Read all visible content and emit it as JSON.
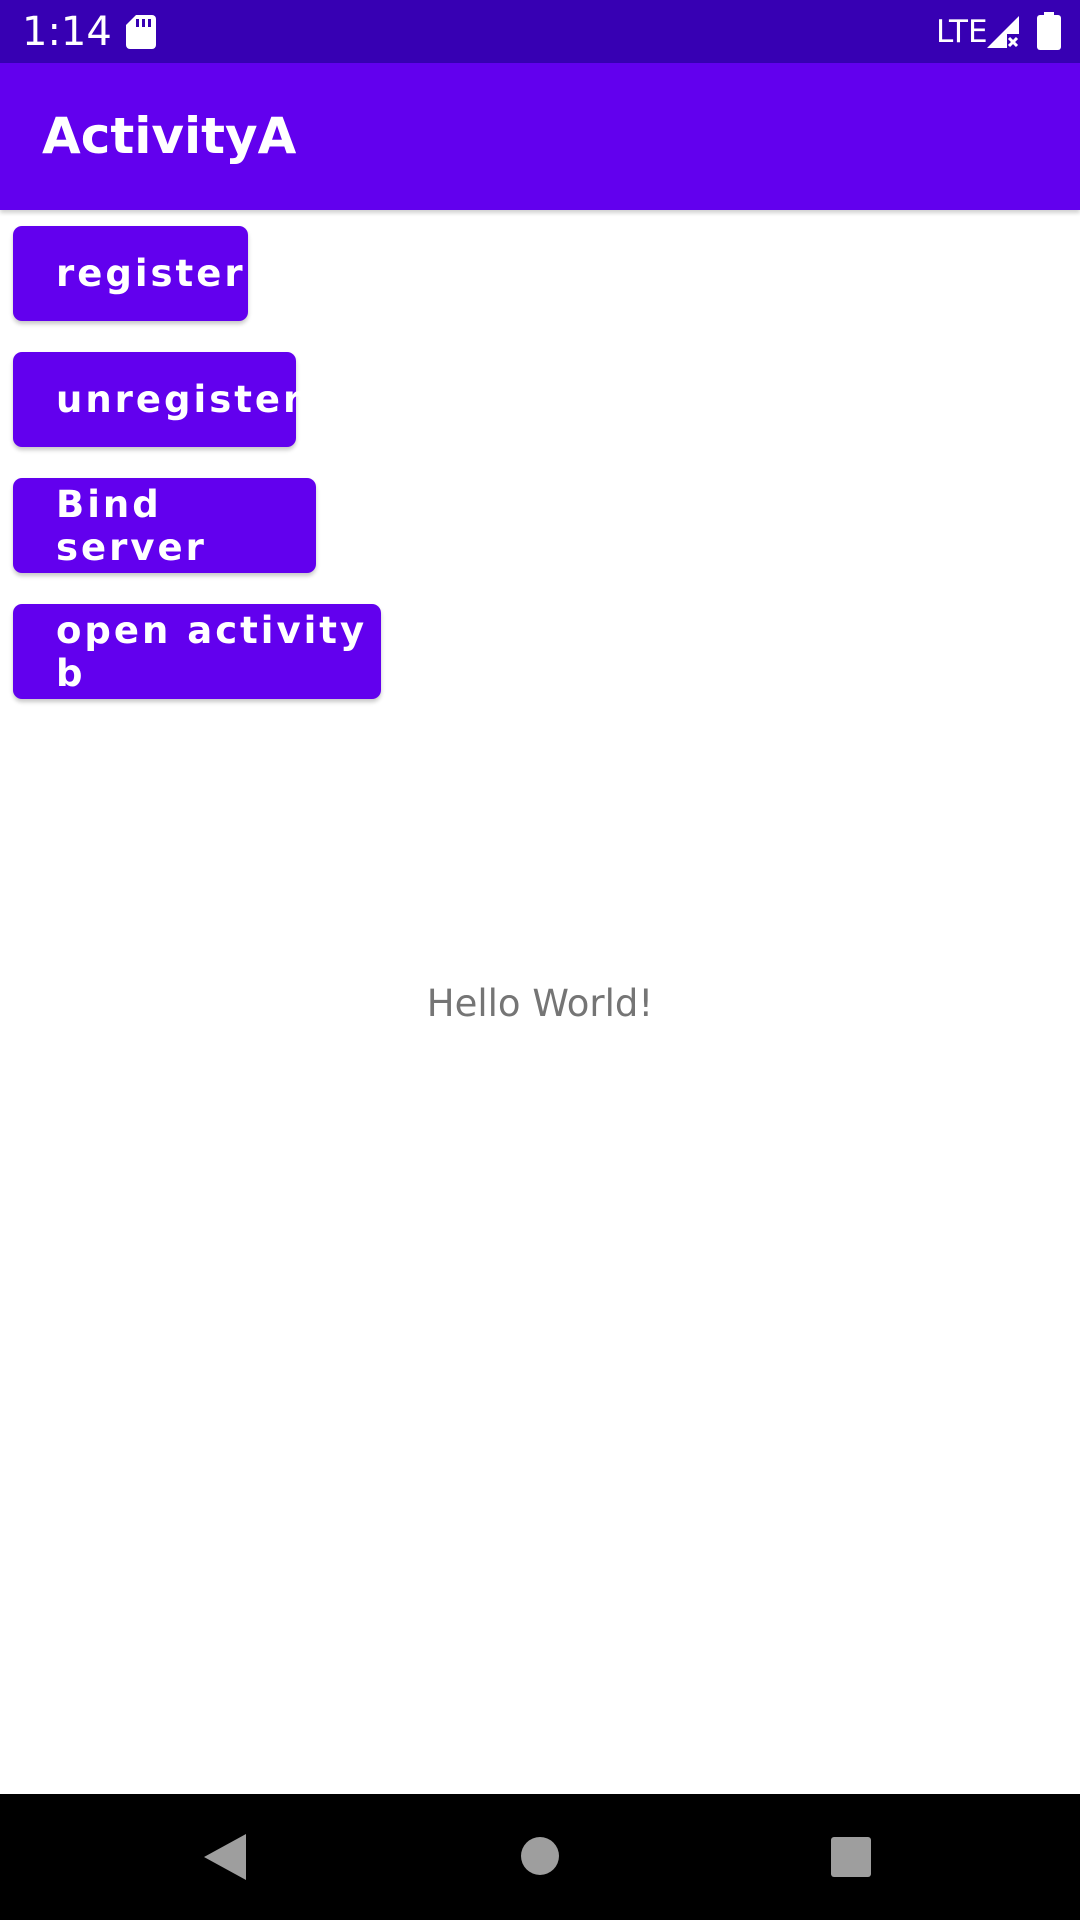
{
  "status_bar": {
    "time": "1:14",
    "network": "LTE",
    "icons": [
      "sd-card-icon",
      "signal-icon",
      "battery-icon"
    ]
  },
  "app_bar": {
    "title": "ActivityA"
  },
  "buttons": {
    "register": "register",
    "unregister": "unregister",
    "bind_server": "Bind server",
    "open_activity_b": "open activity b"
  },
  "content": {
    "message": "Hello World!"
  },
  "nav_bar": {
    "icons": [
      "back-icon",
      "home-icon",
      "recents-icon"
    ]
  },
  "colors": {
    "status_bar": "#3700B3",
    "primary": "#6200EE",
    "text_secondary": "#757575",
    "nav_bar": "#000000"
  }
}
